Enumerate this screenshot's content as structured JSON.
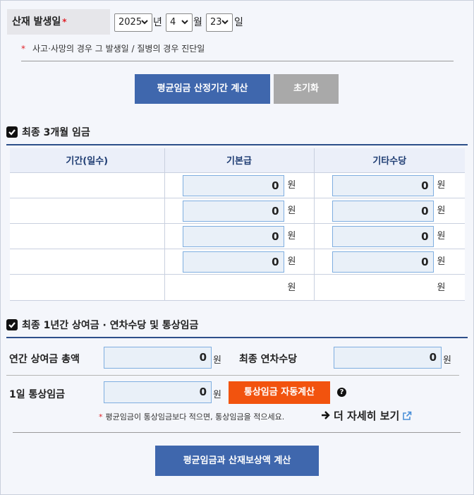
{
  "date": {
    "label": "산재 발생일",
    "required_mark": "*",
    "year": "2025",
    "year_unit": "년",
    "month": "4",
    "month_unit": "월",
    "day": "23",
    "day_unit": "일",
    "note_mark": "*",
    "note": "사고·사망의 경우 그 발생일 / 질병의 경우 진단일"
  },
  "buttons": {
    "calc_period": "평균임금 산정기간 계산",
    "reset": "초기화",
    "auto_calc": "통상임금 자동계산",
    "final_calc": "평균임금과 산재보상액 계산"
  },
  "section1": {
    "title": "최종 3개월 임금",
    "headers": [
      "기간(일수)",
      "기본급",
      "기타수당"
    ],
    "rows": [
      {
        "period": "",
        "basic": "0",
        "other": "0"
      },
      {
        "period": "",
        "basic": "0",
        "other": "0"
      },
      {
        "period": "",
        "basic": "0",
        "other": "0"
      },
      {
        "period": "",
        "basic": "0",
        "other": "0"
      }
    ],
    "unit": "원",
    "total": {
      "period": "",
      "basic_unit": "원",
      "other_unit": "원"
    }
  },
  "section2": {
    "title": "최종 1년간 상여금 · 연차수당 및 통상임금",
    "bonus_label": "연간 상여금 총액",
    "bonus_value": "0",
    "annual_leave_label": "최종 연차수당",
    "annual_leave_value": "0",
    "daily_wage_label": "1일 통상임금",
    "daily_wage_value": "0",
    "unit": "원",
    "help": "?",
    "note_mark": "*",
    "note": "평균임금이 통상임금보다 적으면, 통상임금을 적으세요.",
    "more_link": "더 자세히 보기"
  },
  "colors": {
    "primary": "#3f67ad",
    "secondary": "#a9a9a9",
    "accent": "#f2530e",
    "field_bg": "#e9f0f8",
    "field_border": "#7faee0",
    "header_text": "#1f3d73"
  },
  "icons": {
    "checkbox": "checkbox-checked-icon",
    "dropdown": "chevron-down-icon",
    "help": "question-circle-icon",
    "arrow": "arrow-right-icon",
    "external": "external-link-icon"
  }
}
